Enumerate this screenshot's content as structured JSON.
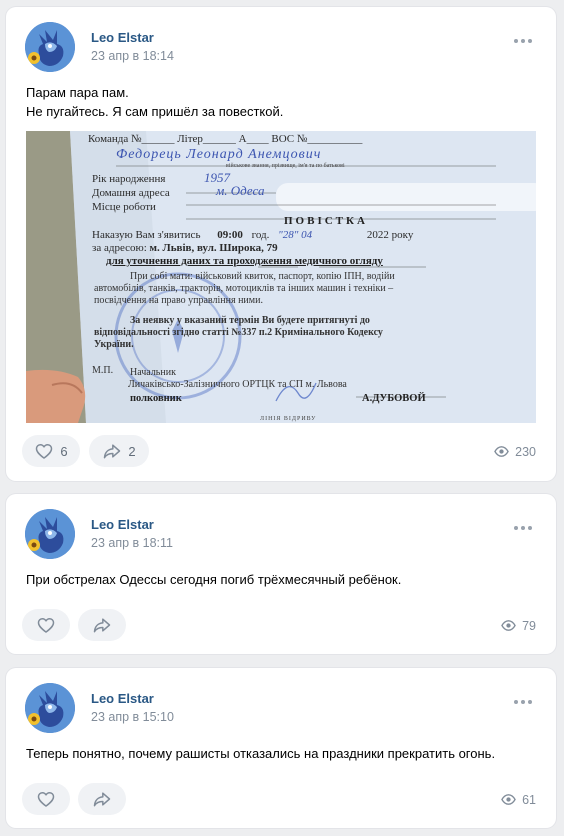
{
  "posts": [
    {
      "author": "Leo Elstar",
      "date": "23 апр в 18:14",
      "text_lines": [
        "Парам пара пам.",
        "Не пугайтесь. Я сам пришёл за повесткой."
      ],
      "likes": "6",
      "reposts": "2",
      "views": "230",
      "photo": {
        "line1": "Команда №______ Літер______ А____ ВОС №__________",
        "name_handwritten": "Федорець Леонард Анемцович",
        "sub_caption": "військове звання, прізвище, ім'я та по батькові",
        "birth_label": "Рік народження",
        "birth_value": "1957",
        "address_label": "Домашня адреса",
        "address_value": "м. Одеса",
        "work_label": "Місце роботи",
        "heading": "ПОВІСТКА",
        "order_text": "Наказую Вам з'явитись",
        "time_value": "09:00",
        "hour_label": "год.",
        "date_value": "\"28\" 04",
        "year_text": "2022 року",
        "address_prefix": "за адресою:",
        "address_city": "м. Львів, вул. Широка, 79",
        "purpose": "для уточнення даних та проходження медичного огляду",
        "docs_text_1": "При собі мати: військовий квиток, паспорт, копію ІПН, водійи",
        "docs_text_2": "автомобілів, танків, тракторів, мотоциклів та інших машин і техніки –",
        "docs_text_3": "посвідчення на право управління ними.",
        "warning_1": "За неявку у вказаний термін Ви будете притягнуті до",
        "warning_2": "відповідальності згідно статті №337 п.2 Кримінального Кодексу",
        "warning_3": "України.",
        "mp": "М.П.",
        "chief": "Начальник",
        "office": "Личаківсько-Залізничного ОРТЦК та СП м. Львова",
        "rank": "полковник",
        "signer": "А.ДУБОВОЙ",
        "tear_line": "ЛІНІЯ ВІДРИВУ"
      }
    },
    {
      "author": "Leo Elstar",
      "date": "23 апр в 18:11",
      "text_lines": [
        "При обстрелах Одессы сегодня погиб трёхмесячный ребёнок."
      ],
      "likes": "",
      "reposts": "",
      "views": "79"
    },
    {
      "author": "Leo Elstar",
      "date": "23 апр в 15:10",
      "text_lines": [
        "Теперь понятно, почему рашисты отказались на праздники прекратить огонь."
      ],
      "likes": "",
      "reposts": "",
      "views": "61"
    }
  ],
  "colors": {
    "link": "#2a5885",
    "muted": "#818c99",
    "pill_bg": "#f0f2f5",
    "page_bg": "#edeef0"
  }
}
